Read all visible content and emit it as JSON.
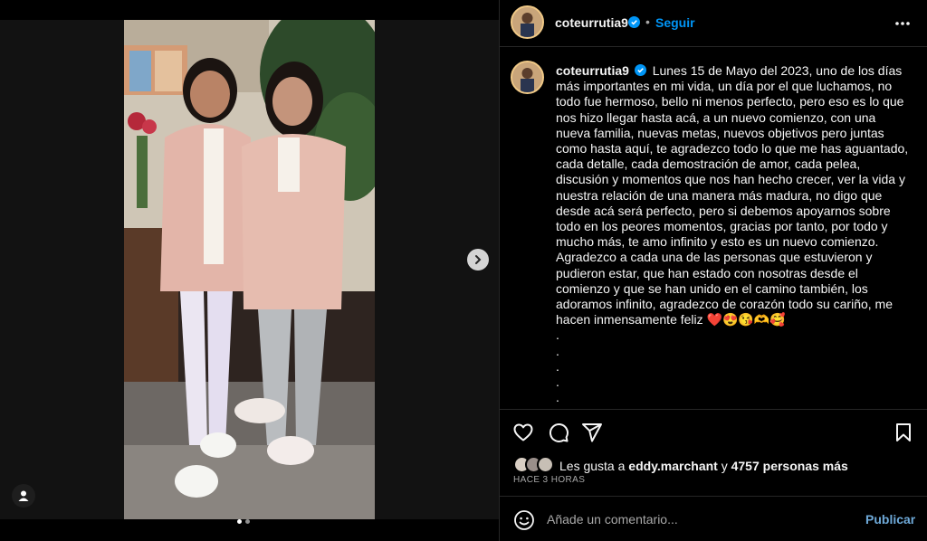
{
  "post": {
    "username": "coteurrutia9",
    "follow_label": "Seguir",
    "separator": "•",
    "caption": "Lunes 15 de Mayo del 2023, uno de los días más importantes en mi vida, un día por el que luchamos, no todo fue hermoso, bello ni menos perfecto, pero eso es lo que nos hizo llegar hasta acá, a un nuevo comienzo, con una nueva familia, nuevas metas, nuevos objetivos pero juntas como hasta aquí, te agradezco todo lo que me has aguantado, cada detalle, cada demostración de amor, cada pelea, discusión y momentos que nos han hecho crecer, ver la vida y nuestra relación de una manera más madura, no digo que desde acá será perfecto, pero si debemos apoyarnos sobre todo en los peores momentos, gracias por tanto, por todo y mucho más, te amo infinito y esto es un nuevo comienzo.\nAgradezco a cada una de las personas que estuvieron y pudieron estar, que han estado con nosotras desde el comienzo y que se han unido en el camino también, los adoramos infinito, agradezco de corazón todo su cariño, me hacen inmensamente feliz ❤️😍😘🫶🥰",
    "caption_dots": ".\n.\n.\n.\n."
  },
  "likes": {
    "prefix": "Les gusta a",
    "user": "eddy.marchant",
    "middle": "y",
    "count_text": "4757 personas más",
    "time_ago": "HACE 3 HORAS"
  },
  "comment": {
    "placeholder": "Añade un comentario...",
    "publish_label": "Publicar"
  },
  "carousel": {
    "total": 2,
    "active_index": 0
  },
  "icons": {
    "verified": "verified-badge-icon",
    "more": "more-options-icon",
    "like": "heart-icon",
    "comment": "comment-icon",
    "share": "share-icon",
    "save": "bookmark-icon",
    "emoji": "emoji-icon",
    "next": "chevron-right-icon",
    "user_tag": "user-tag-icon"
  },
  "colors": {
    "background": "#000000",
    "text": "#f5f5f5",
    "muted": "#a8a8a8",
    "link_blue": "#0095f6",
    "divider": "#262626"
  }
}
